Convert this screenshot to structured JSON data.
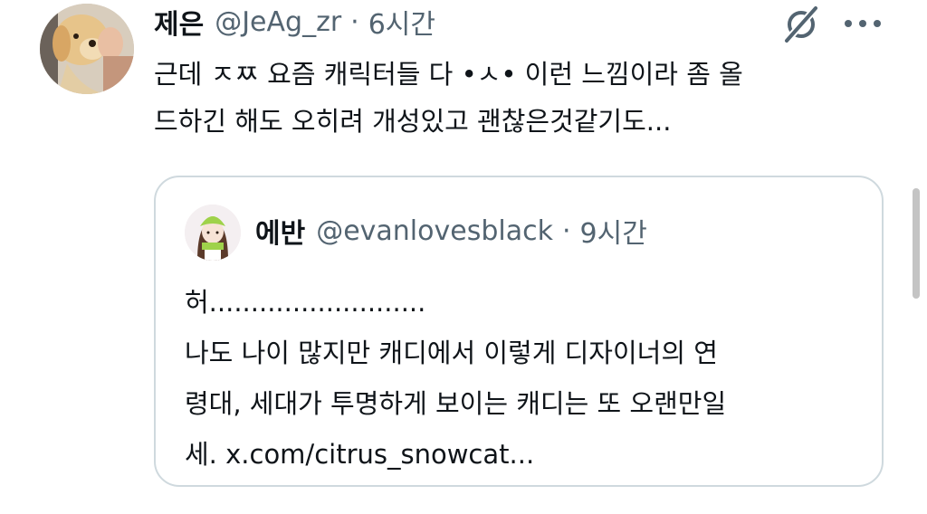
{
  "post": {
    "display_name": "제은",
    "handle": "@JeAg_zr",
    "separator": "·",
    "time": "6시간",
    "text_lines": [
      "근데 ㅈㅉ 요즘 캐릭터들 다 •ㅅ• 이런 느낌이라 좀 올",
      "드하긴 해도 오히려 개성있고 괜찮은것같기도..."
    ]
  },
  "quoted_post": {
    "display_name": "에반",
    "handle": "@evanlovesblack",
    "separator": "·",
    "time": "9시간",
    "text_lines": [
      "허..........................",
      "나도 나이 많지만 캐디에서 이렇게 디자이너의 연",
      "령대, 세대가 투명하게 보이는 캐디는 또 오랜만일",
      "세. x.com/citrus_snowcat..."
    ]
  },
  "icons": {
    "grok": "grok-icon",
    "more": "more-icon"
  },
  "colors": {
    "text_primary": "#0f1419",
    "text_secondary": "#536471",
    "border": "#cfd9de"
  }
}
